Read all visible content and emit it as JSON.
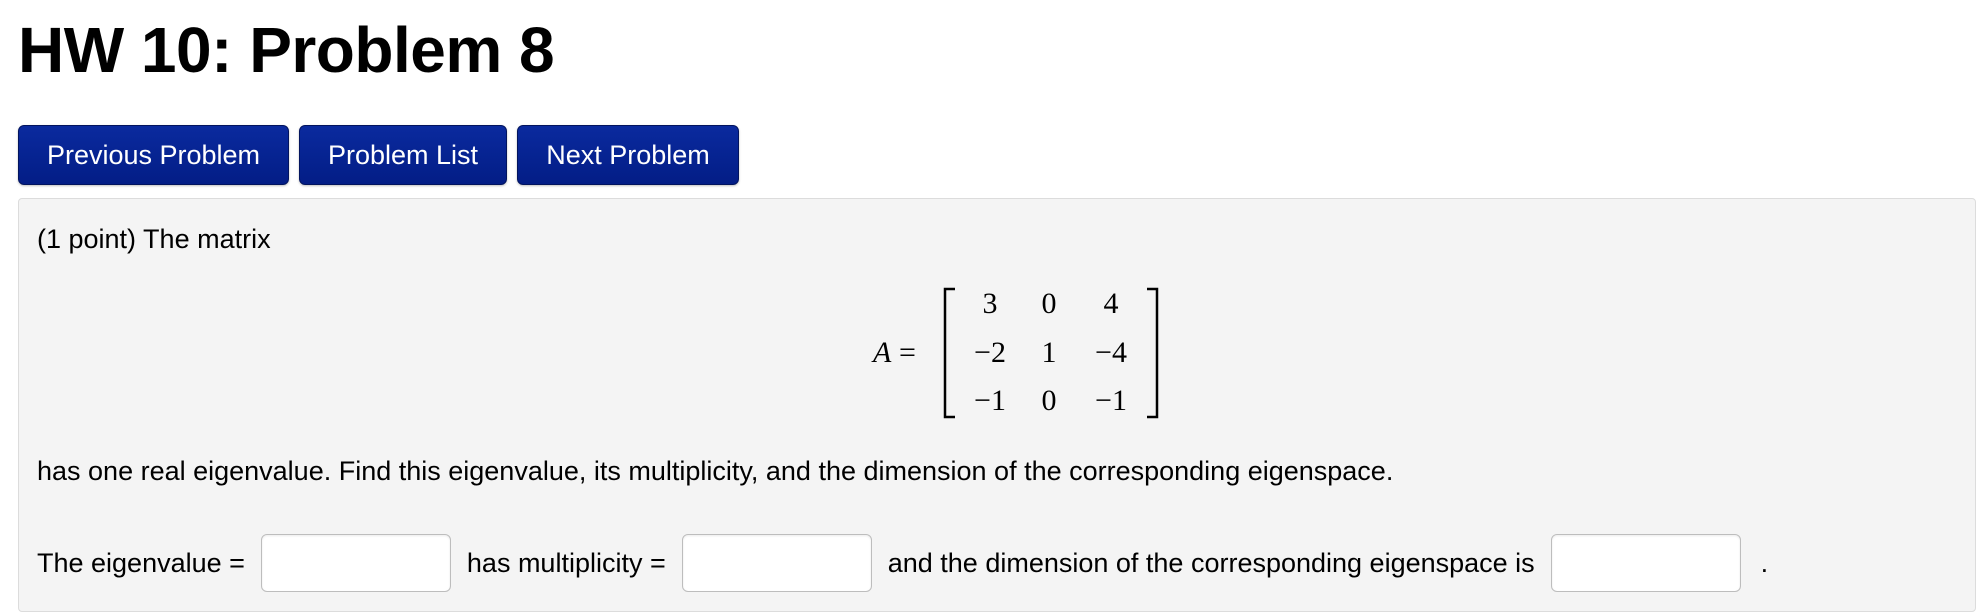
{
  "header": {
    "title": "HW 10: Problem 8"
  },
  "nav": {
    "previous_label": "Previous Problem",
    "list_label": "Problem List",
    "next_label": "Next Problem"
  },
  "problem": {
    "intro": "(1 point) The matrix",
    "matrix_label": "A =",
    "matrix": [
      [
        "3",
        "0",
        "4"
      ],
      [
        "−2",
        "1",
        "−4"
      ],
      [
        "−1",
        "0",
        "−1"
      ]
    ],
    "statement": "has one real eigenvalue. Find this eigenvalue, its multiplicity, and the dimension of the corresponding eigenspace.",
    "eigenvalue_label": "The eigenvalue =",
    "eigenvalue_value": "",
    "multiplicity_label": "has multiplicity =",
    "multiplicity_value": "",
    "dimension_label": "and the dimension of the corresponding eigenspace is",
    "dimension_value": "",
    "end_punct": "."
  },
  "colors": {
    "nav_button_bg": "#031d86",
    "problem_bg": "#f4f4f4"
  }
}
